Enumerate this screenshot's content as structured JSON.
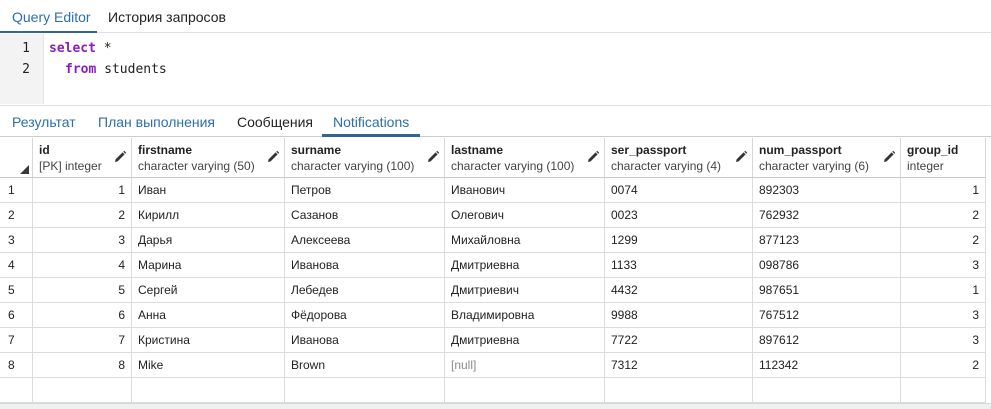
{
  "editor_tabs": [
    {
      "label": "Query Editor",
      "active": true
    },
    {
      "label": "История запросов",
      "active": false
    }
  ],
  "editor": {
    "lines": [
      {
        "number": "1",
        "keyword": "select",
        "rest": " *"
      },
      {
        "number": "2",
        "keyword": "from",
        "rest": " students"
      }
    ]
  },
  "result_tabs": [
    {
      "label": "Результат",
      "style": "link"
    },
    {
      "label": "План выполнения",
      "style": "link"
    },
    {
      "label": "Сообщения",
      "style": "plain"
    },
    {
      "label": "Notifications",
      "style": "link",
      "active": true
    }
  ],
  "grid": {
    "columns": [
      {
        "name": "id",
        "type": "[PK] integer",
        "align": "right"
      },
      {
        "name": "firstname",
        "type": "character varying (50)",
        "align": "left"
      },
      {
        "name": "surname",
        "type": "character varying (100)",
        "align": "left"
      },
      {
        "name": "lastname",
        "type": "character varying (100)",
        "align": "left"
      },
      {
        "name": "ser_passport",
        "type": "character varying (4)",
        "align": "left"
      },
      {
        "name": "num_passport",
        "type": "character varying (6)",
        "align": "left"
      },
      {
        "name": "group_id",
        "type": "integer",
        "align": "right"
      }
    ],
    "rows": [
      {
        "rownum": "1",
        "cells": [
          "1",
          "Иван",
          "Петров",
          "Иванович",
          "0074",
          "892303",
          "1"
        ]
      },
      {
        "rownum": "2",
        "cells": [
          "2",
          "Кирилл",
          "Сазанов",
          "Олегович",
          "0023",
          "762932",
          "2"
        ]
      },
      {
        "rownum": "3",
        "cells": [
          "3",
          "Дарья",
          "Алексеева",
          "Михайловна",
          "1299",
          "877123",
          "2"
        ]
      },
      {
        "rownum": "4",
        "cells": [
          "4",
          "Марина",
          "Иванова",
          "Дмитриевна",
          "1133",
          "098786",
          "3"
        ]
      },
      {
        "rownum": "5",
        "cells": [
          "5",
          "Сергей",
          "Лебедев",
          "Дмитриевич",
          "4432",
          "987651",
          "1"
        ]
      },
      {
        "rownum": "6",
        "cells": [
          "6",
          "Анна",
          "Фёдорова",
          "Владимировна",
          "9988",
          "767512",
          "3"
        ]
      },
      {
        "rownum": "7",
        "cells": [
          "7",
          "Кристина",
          "Иванова",
          "Дмитриевна",
          "7722",
          "897612",
          "3"
        ]
      },
      {
        "rownum": "8",
        "cells": [
          "8",
          "Mike",
          "Brown",
          "[null]",
          "7312",
          "112342",
          "2"
        ]
      }
    ]
  },
  "colors": {
    "accent": "#326690",
    "link": "#2c6fad",
    "keyword": "#8a1ec2",
    "null_text": "#8a8a8a"
  },
  "icons": {
    "column_edit": "pencil-icon",
    "sort_corner": "corner-triangle-icon"
  }
}
